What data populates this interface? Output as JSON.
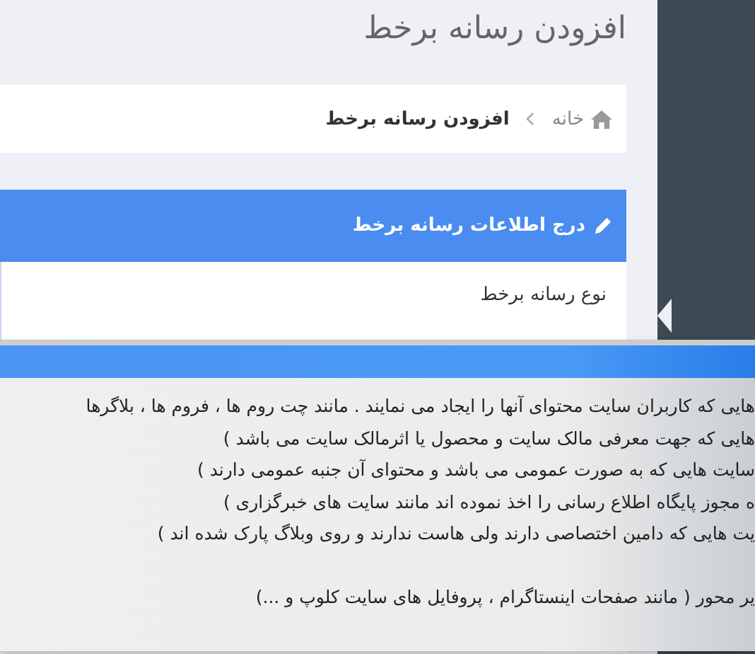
{
  "page_title": "افزودن رسانه برخط",
  "breadcrumb": [
    {
      "label": "خانه",
      "kind": "home"
    },
    {
      "label": "افزودن رسانه برخط",
      "kind": "current"
    }
  ],
  "panel": {
    "title": "درج اطلاعات رسانه برخط",
    "field_label": "نوع رسانه برخط"
  },
  "popup": {
    "paragraphs": [
      [
        "هایی که کاربران سایت محتوای آنها را ایجاد می نمایند . مانند چت روم ها ، فروم ها ، بلاگرها",
        "هایی که جهت معرفی مالک سایت و محصول یا اثرمالک سایت می باشد )",
        "سایت هایی که به صورت عمومی می باشد و محتوای آن جنبه عمومی دارند )",
        "ه مجوز پایگاه اطلاع رسانی را اخذ نموده اند مانند سایت های خبرگزاری )",
        "یت هایی که دامین اختصاصی دارند ولی هاست ندارند و روی وبلاگ پارک شده اند )"
      ],
      [
        "یر محور ( مانند صفحات اینستاگرام ، پروفایل های سایت کلوپ و ...)"
      ]
    ]
  }
}
